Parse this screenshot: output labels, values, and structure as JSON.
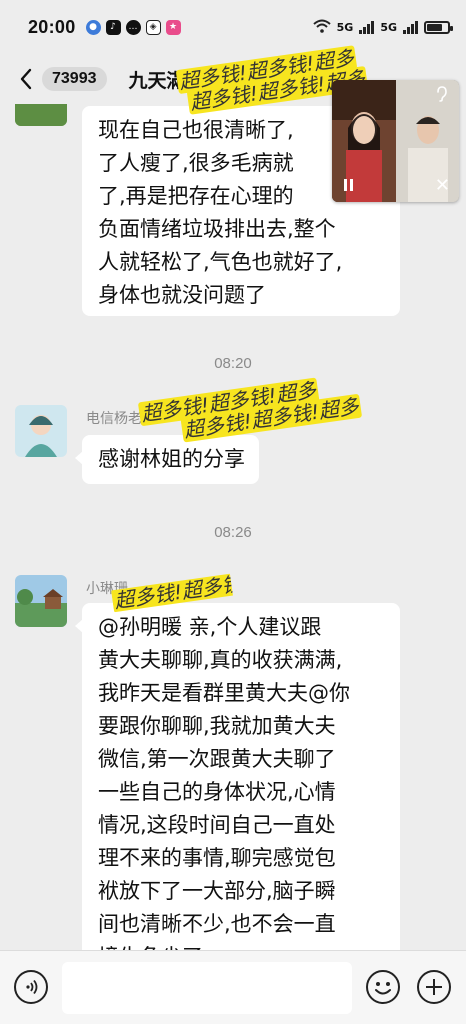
{
  "status_bar": {
    "time": "20:00",
    "network_1": "5G",
    "network_2": "5G"
  },
  "header": {
    "unread_count": "73993",
    "title": "九天",
    "title_tail": "滿"
  },
  "sticker": {
    "text": "超多钱!超多钱!超多",
    "text_row2": "超多钱!超多钱!超多"
  },
  "messages": [
    {
      "type": "text",
      "lines": [
        "现在自己也很清晰了,",
        "了人瘦了,很多毛病就",
        "了,再是把存在心理的",
        "负面情绪垃圾排出去,整个",
        "人就轻松了,气色也就好了,",
        "身体也就没问题了"
      ]
    },
    {
      "type": "timestamp",
      "text": "08:20"
    },
    {
      "type": "text",
      "sender": "电信杨",
      "sender_tail": "老",
      "lines": [
        "感谢林姐的分享"
      ]
    },
    {
      "type": "timestamp",
      "text": "08:26"
    },
    {
      "type": "text",
      "sender": "小琳珊",
      "lines": [
        "@孙明暖  亲,个人建议跟",
        "黄大夫聊聊,真的收获满满,",
        "我昨天是看群里黄大夫@你",
        "要跟你聊聊,我就加黄大夫",
        "微信,第一次跟黄大夫聊了",
        "一些自己的身体状况,心情",
        "情况,这段时间自己一直处",
        "理不来的事情,聊完感觉包",
        "袱放下了一大部分,脑子瞬",
        "间也清晰不少,也不会一直",
        "境生角尖了"
      ]
    }
  ],
  "bottom_bar": {
    "input_value": "",
    "input_placeholder": ""
  },
  "icons": {
    "back": "chevron-left-icon",
    "voice": "voice-icon",
    "emoji": "emoji-icon",
    "plus": "plus-icon",
    "pause": "pause-icon",
    "close": "close-icon",
    "earpiece": "earpiece-icon"
  },
  "colors": {
    "background": "#ededed",
    "bubble": "#ffffff",
    "sticker_yellow": "#f7e51f",
    "timestamp": "#8a8a8a"
  }
}
